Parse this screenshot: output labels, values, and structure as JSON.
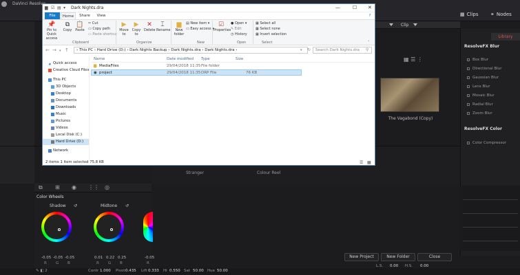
{
  "app": {
    "title": "DaVinci Resolve",
    "clips_label": "Clips",
    "nodes_label": "Nodes"
  },
  "viewer": {
    "clip_label": "Clip",
    "thumbnail_caption": "The Vagabond (Copy)"
  },
  "library": {
    "tab_label": "Library",
    "groups": [
      {
        "heading": "ResolveFX Blur",
        "items": [
          "Box Blur",
          "Directional Blur",
          "Gaussian Blur",
          "Lens Blur",
          "Mosaic Blur",
          "Radial Blur",
          "Zoom Blur"
        ]
      },
      {
        "heading": "ResolveFX Color",
        "items": [
          "Color Compressor"
        ]
      }
    ]
  },
  "media_pool": {
    "bins": [
      "Stranger",
      "Colour Reel"
    ],
    "buttons": [
      "New Project",
      "New Folder",
      "Close"
    ]
  },
  "color_wheels": {
    "panel_title": "Color Wheels",
    "wheels": [
      {
        "label": "Shadow",
        "values": [
          "-0.05",
          "-0.05",
          "-0.05"
        ]
      },
      {
        "label": "Midtone",
        "values": [
          "0.01",
          "0.22",
          "0.25"
        ]
      },
      {
        "label": "",
        "values": [
          "-0.05"
        ]
      }
    ],
    "channels": [
      "R",
      "G",
      "B"
    ]
  },
  "bottom_bar": {
    "items": [
      {
        "label": "Contr",
        "value": "1.000"
      },
      {
        "label": "Pivot",
        "value": "0.435"
      },
      {
        "label": "Lift",
        "value": "0.333"
      },
      {
        "label": "Hi",
        "value": "0.550"
      },
      {
        "label": "Sat",
        "value": "50.00"
      },
      {
        "label": "Hue",
        "value": "50.00"
      }
    ],
    "ls_label": "L.S.",
    "ls_value": "0.00",
    "hs_label": "H.S.",
    "hs_value": "0.00"
  },
  "explorer": {
    "title": "Dark Nights.dra",
    "tabs": [
      "File",
      "Home",
      "Share",
      "View"
    ],
    "ribbon": {
      "clipboard": {
        "group_label": "Clipboard",
        "pin": "Pin to Quick access",
        "copy": "Copy",
        "paste": "Paste",
        "cut": "Cut",
        "copy_path": "Copy path",
        "paste_shortcut": "Paste shortcut"
      },
      "organize": {
        "group_label": "Organize",
        "move_to": "Move to",
        "copy_to": "Copy to",
        "delete": "Delete",
        "rename": "Rename"
      },
      "new": {
        "group_label": "New",
        "new_folder": "New folder",
        "new_item": "New item",
        "easy_access": "Easy access"
      },
      "open": {
        "group_label": "Open",
        "properties": "Properties",
        "open": "Open",
        "edit": "Edit",
        "history": "History"
      },
      "select": {
        "group_label": "Select",
        "select_all": "Select all",
        "select_none": "Select none",
        "invert": "Invert selection"
      }
    },
    "address": "›  This PC  ›  Hard Drive (D:)  ›  Dark Nights Backup  ›  Dark Nights.dra  ›  Dark Nights.dra  ›",
    "search_placeholder": "Search Dark Nights.dra",
    "nav_items": [
      {
        "label": "Quick access",
        "color": "#1979ca"
      },
      {
        "label": "Creative Cloud Files",
        "color": "#e8503a"
      },
      {
        "label": "This PC",
        "color": "#4a8fd8"
      },
      {
        "label": "3D Objects",
        "color": "#5aa0e0"
      },
      {
        "label": "Desktop",
        "color": "#3a7fd0"
      },
      {
        "label": "Documents",
        "color": "#6a8fb8"
      },
      {
        "label": "Downloads",
        "color": "#2a70c8"
      },
      {
        "label": "Music",
        "color": "#3a80d0"
      },
      {
        "label": "Pictures",
        "color": "#5a9ad8"
      },
      {
        "label": "Videos",
        "color": "#6a7fb8"
      },
      {
        "label": "Local Disk (C:)",
        "color": "#999999"
      },
      {
        "label": "Hard Drive (D:)",
        "color": "#777777"
      },
      {
        "label": "Network",
        "color": "#4a80c8"
      }
    ],
    "columns": [
      "Name",
      "Date modified",
      "Type",
      "Size"
    ],
    "files": [
      {
        "name": "MediaFiles",
        "date": "29/04/2018 11:35",
        "type": "File folder",
        "size": ""
      },
      {
        "name": "project",
        "date": "29/04/2018 11:35",
        "type": "DRP File",
        "size": "76 KB"
      }
    ],
    "status": "2 items     1 item selected  75.8 KB"
  }
}
